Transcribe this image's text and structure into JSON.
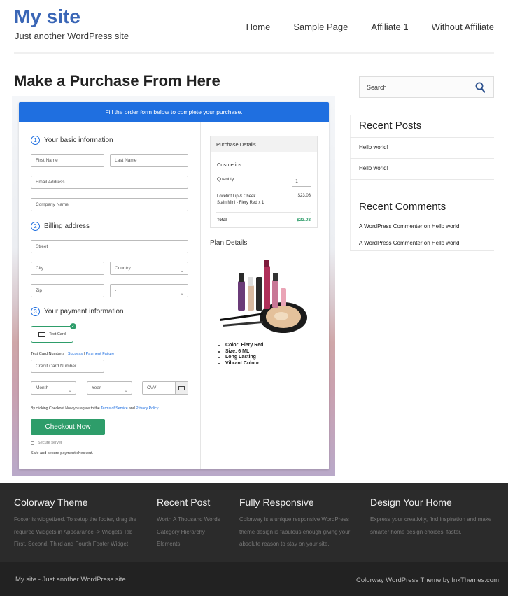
{
  "header": {
    "site_title": "My site",
    "site_desc": "Just another WordPress site",
    "nav": [
      "Home",
      "Sample Page",
      "Affiliate 1",
      "Without Affiliate"
    ]
  },
  "page": {
    "title": "Make a Purchase From Here"
  },
  "checkout": {
    "banner": "Fill the order form below to complete your purchase.",
    "sections": {
      "basic": {
        "num": "1",
        "label": "Your basic information"
      },
      "billing": {
        "num": "2",
        "label": "Billing address"
      },
      "payment": {
        "num": "3",
        "label": "Your payment information"
      }
    },
    "placeholders": {
      "first_name": "First Name",
      "last_name": "Last Name",
      "email": "Email Address",
      "company": "Company Name",
      "street": "Street",
      "city": "City",
      "country": "Country",
      "zip": "Zip",
      "state": "-",
      "card_number": "Credit Card Number",
      "month": "Month",
      "year": "Year",
      "cvv": "CVV"
    },
    "test_card_label": "Test Card",
    "test_numbers_prefix": "Test Card Numbers : ",
    "test_success": "Success",
    "test_separator": " | ",
    "test_failure": "Payment Failure",
    "agree_prefix": "By clicking Checkout Now you agree to the ",
    "terms": "Terms of Service",
    "and": " and ",
    "privacy": "Privacy Policy",
    "checkout_button": "Checkout Now",
    "secure_server": "Secure server",
    "safe_text": "Safe and secure payment checkout."
  },
  "purchase": {
    "head": "Purchase Details",
    "product_group": "Cosmetics",
    "quantity_label": "Quantity",
    "quantity_value": "1",
    "item_line1": "Lovetint Lip & Cheek",
    "item_line2": "Stain Mini - Fiery Red x 1",
    "item_price": "$23.03",
    "total_label": "Total",
    "total_value": "$23.03"
  },
  "plan": {
    "title": "Plan Details",
    "items": [
      "Color: Fiery Red",
      "Size: 6 ML",
      "Long Lasting",
      "Vibrant Colour"
    ]
  },
  "sidebar": {
    "search_placeholder": "Search",
    "recent_posts_title": "Recent Posts",
    "recent_posts": [
      "Hello world!",
      "Hello world!"
    ],
    "recent_comments_title": "Recent Comments",
    "comments": [
      {
        "author": "A WordPress Commenter",
        "on": " on ",
        "post": "Hello world!"
      },
      {
        "author": "A WordPress Commenter",
        "on": " on ",
        "post": "Hello world!"
      }
    ]
  },
  "footer": {
    "cols": [
      {
        "title": "Colorway Theme",
        "lines": [
          "Footer is widgetized. To setup the footer, drag the",
          "required Widgets in Appearance -> Widgets Tab",
          "First, Second, Third and Fourth Footer Widget"
        ]
      },
      {
        "title": "Recent Post",
        "lines": [
          "Worth A Thousand Words",
          "Category Hierarchy",
          "Elements"
        ]
      },
      {
        "title": "Fully Responsive",
        "lines": [
          "Colorway is a unique responsive WordPress",
          "theme design is fabulous enough giving your",
          "absolute reason to stay on your site."
        ]
      },
      {
        "title": "Design Your Home",
        "lines": [
          "Express your creativity, find inspiration and make",
          "smarter home design choices, faster."
        ]
      }
    ],
    "bottom_left": "My site - Just another WordPress site",
    "bottom_right": "Colorway WordPress Theme by InkThemes.com"
  },
  "colors": {
    "accent": "#3a66b6",
    "banner": "#1f6fe0",
    "button": "#2e9d6a",
    "footer": "#2b2b2b"
  }
}
